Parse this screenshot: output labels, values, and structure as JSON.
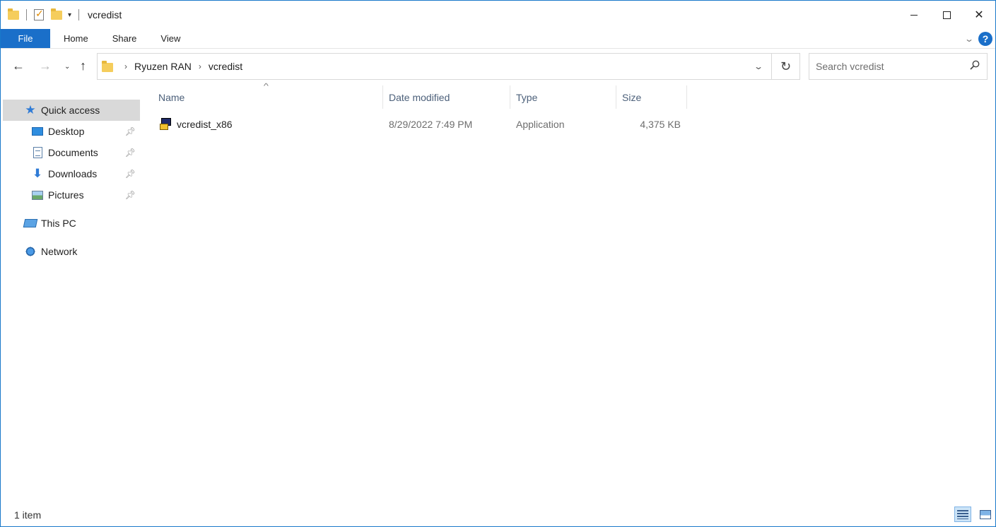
{
  "window": {
    "title": "vcredist",
    "controls": {
      "minimize": "minimize-icon",
      "maximize": "maximize-icon",
      "close": "✕"
    }
  },
  "ribbon": {
    "tabs": [
      "File",
      "Home",
      "Share",
      "View"
    ]
  },
  "navigation": {
    "breadcrumb": [
      "Ryuzen RAN",
      "vcredist"
    ],
    "search_placeholder": "Search vcredist"
  },
  "sidebar": {
    "items": [
      {
        "label": "Quick access",
        "icon": "star-icon",
        "active": true,
        "pinned": false
      },
      {
        "label": "Desktop",
        "icon": "desktop-icon",
        "active": false,
        "pinned": true
      },
      {
        "label": "Documents",
        "icon": "documents-icon",
        "active": false,
        "pinned": true
      },
      {
        "label": "Downloads",
        "icon": "downloads-icon",
        "active": false,
        "pinned": true
      },
      {
        "label": "Pictures",
        "icon": "pictures-icon",
        "active": false,
        "pinned": true
      },
      {
        "label": "This PC",
        "icon": "computer-icon",
        "active": false,
        "pinned": false
      },
      {
        "label": "Network",
        "icon": "network-icon",
        "active": false,
        "pinned": false
      }
    ]
  },
  "file_list": {
    "columns": [
      "Name",
      "Date modified",
      "Type",
      "Size"
    ],
    "sorted_by": "Name",
    "rows": [
      {
        "name": "vcredist_x86",
        "date_modified": "8/29/2022 7:49 PM",
        "type": "Application",
        "size": "4,375 KB",
        "icon": "application-icon"
      }
    ]
  },
  "status_bar": {
    "item_count": "1 item",
    "view_mode": "details"
  },
  "colors": {
    "accent": "#1a6fc9",
    "window_border": "#1979ca",
    "sidebar_active": "#d9d9d9",
    "column_header_text": "#4c607a"
  }
}
